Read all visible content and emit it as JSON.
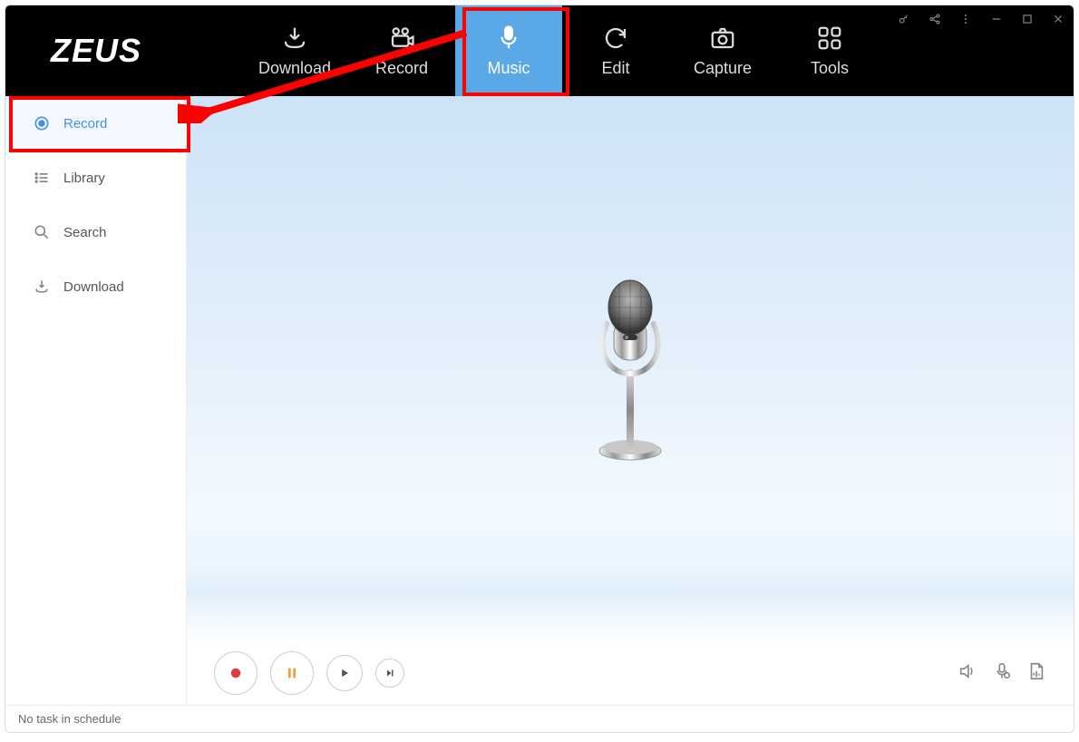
{
  "app": {
    "brand": "ZEUS"
  },
  "nav": {
    "download": "Download",
    "record": "Record",
    "music": "Music",
    "edit": "Edit",
    "capture": "Capture",
    "tools": "Tools"
  },
  "sidebar": {
    "record": "Record",
    "library": "Library",
    "search": "Search",
    "download": "Download"
  },
  "footer": {
    "status": "No task in schedule"
  }
}
